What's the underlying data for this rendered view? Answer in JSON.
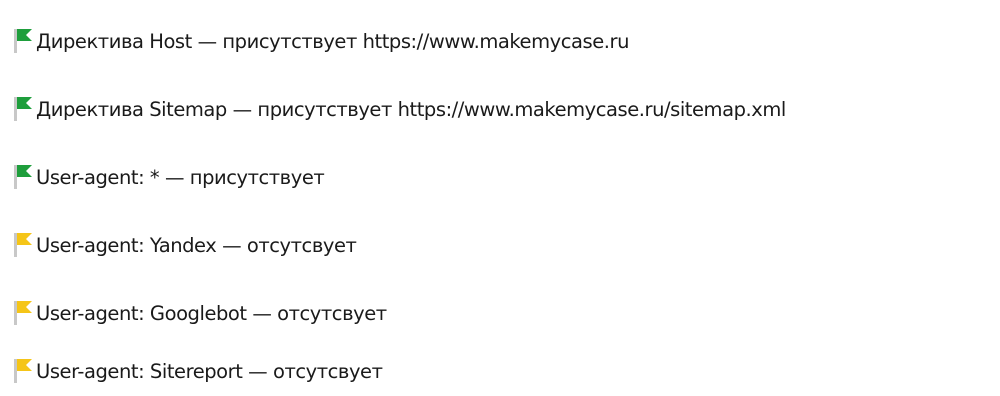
{
  "colors": {
    "flag_ok": "#1e9e3c",
    "flag_warn": "#f5c518",
    "flag_pole": "#c8c8c8",
    "text": "#1a1a1a"
  },
  "items": [
    {
      "status": "ok",
      "icon": "green-flag-icon",
      "text": "Директива Host — присутствует https://www.makemycase.ru"
    },
    {
      "status": "ok",
      "icon": "green-flag-icon",
      "text": "Директива Sitemap — присутствует https://www.makemycase.ru/sitemap.xml"
    },
    {
      "status": "ok",
      "icon": "green-flag-icon",
      "text": "User-agent: * — присутствует"
    },
    {
      "status": "warn",
      "icon": "yellow-flag-icon",
      "text": "User-agent: Yandex — отсутсвует"
    },
    {
      "status": "warn",
      "icon": "yellow-flag-icon",
      "text": "User-agent: Googlebot — отсутсвует"
    },
    {
      "status": "warn",
      "icon": "yellow-flag-icon",
      "text": "User-agent: Sitereport — отсутсвует"
    }
  ]
}
